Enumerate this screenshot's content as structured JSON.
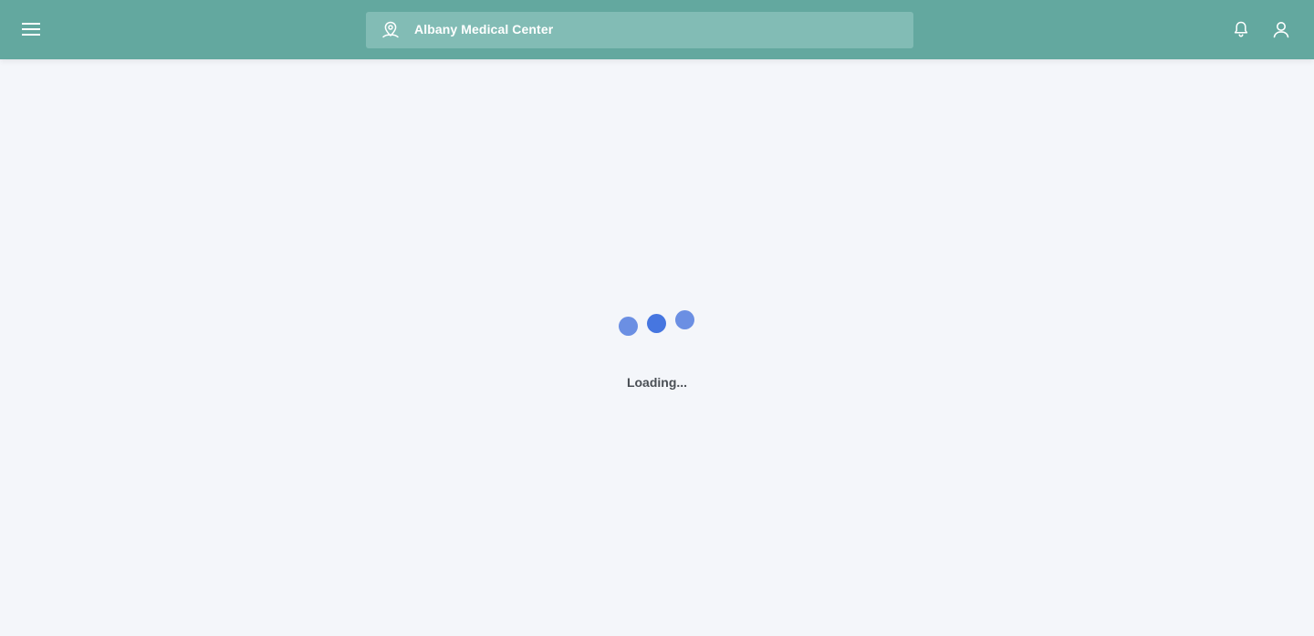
{
  "header": {
    "location_name": "Albany Medical Center",
    "icons": {
      "menu": "hamburger-menu-icon",
      "location": "location-pin-icon",
      "notifications": "bell-icon",
      "account": "user-icon"
    },
    "colors": {
      "header_bg": "#63a89f",
      "location_bg": "#82bcb5",
      "icon": "#ffffff"
    }
  },
  "main": {
    "loading_text": "Loading...",
    "spinner_color": "#4676e0",
    "background": "#f4f6fa"
  }
}
